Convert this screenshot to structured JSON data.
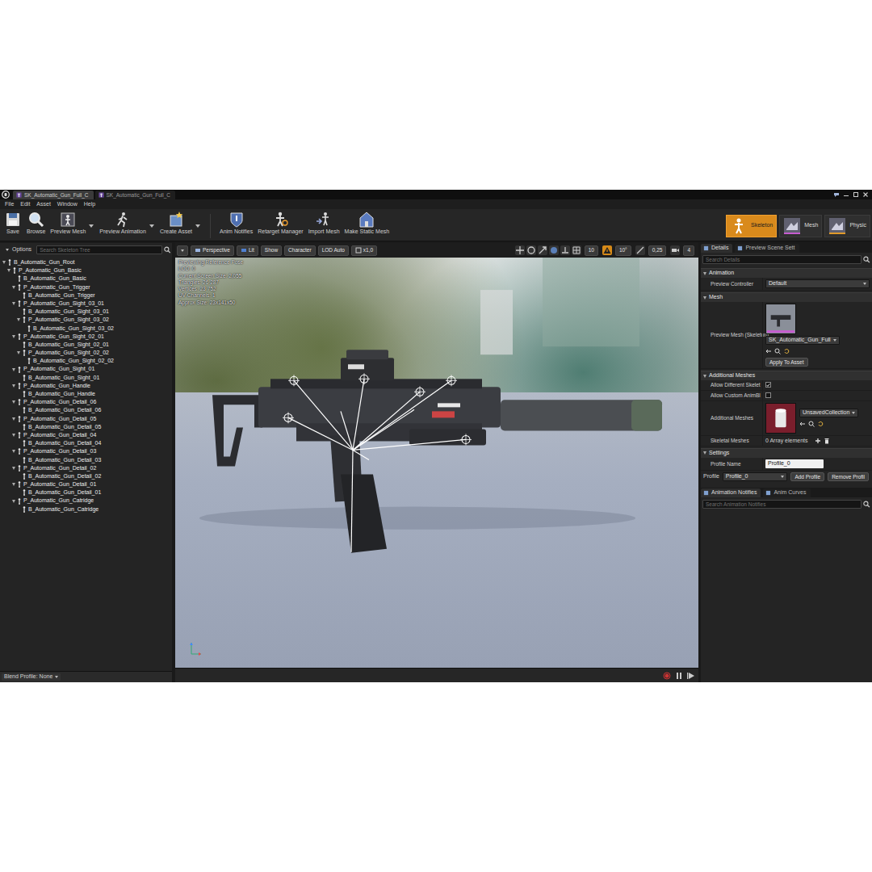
{
  "window": {
    "tabs": [
      {
        "label": "SK_Automatic_Gun_Full_C",
        "selected": true
      },
      {
        "label": "SK_Automatic_Gun_Full_C",
        "selected": false
      }
    ]
  },
  "menu": [
    "File",
    "Edit",
    "Asset",
    "Window",
    "Help"
  ],
  "toolbar": {
    "buttons": [
      {
        "label": "Save",
        "has_menu": false
      },
      {
        "label": "Browse",
        "has_menu": false
      },
      {
        "label": "Preview Mesh",
        "has_menu": true
      },
      {
        "label": "Preview Animation",
        "has_menu": true
      },
      {
        "label": "Create Asset",
        "has_menu": true
      },
      {
        "label": "Anim Notifies",
        "has_menu": false
      },
      {
        "label": "Retarget Manager",
        "has_menu": false
      },
      {
        "label": "Import Mesh",
        "has_menu": false
      },
      {
        "label": "Make Static Mesh",
        "has_menu": false
      }
    ],
    "modes": [
      {
        "label": "Skeleton",
        "selected": true
      },
      {
        "label": "Mesh",
        "selected": false
      },
      {
        "label": "Physic",
        "selected": false
      }
    ]
  },
  "skeleton_tree": {
    "options": "Options",
    "search": {
      "placeholder": "Search Skeleton Tree"
    },
    "items": [
      {
        "label": "B_Automatic_Gun_Root",
        "expanded": true,
        "children": [
          {
            "label": "P_Automatic_Gun_Basic",
            "expanded": true,
            "children": [
              {
                "label": "B_Automatic_Gun_Basic",
                "children": []
              },
              {
                "label": "P_Automatic_Gun_Trigger",
                "expanded": true,
                "children": [
                  {
                    "label": "B_Automatic_Gun_Trigger",
                    "children": []
                  }
                ]
              },
              {
                "label": "P_Automatic_Gun_Sight_03_01",
                "expanded": true,
                "children": [
                  {
                    "label": "B_Automatic_Gun_Sight_03_01",
                    "children": []
                  },
                  {
                    "label": "P_Automatic_Gun_Sight_03_02",
                    "expanded": true,
                    "children": [
                      {
                        "label": "B_Automatic_Gun_Sight_03_02",
                        "children": []
                      }
                    ]
                  }
                ]
              },
              {
                "label": "P_Automatic_Gun_Sight_02_01",
                "expanded": true,
                "children": [
                  {
                    "label": "B_Automatic_Gun_Sight_02_01",
                    "children": []
                  },
                  {
                    "label": "P_Automatic_Gun_Sight_02_02",
                    "expanded": true,
                    "children": [
                      {
                        "label": "B_Automatic_Gun_Sight_02_02",
                        "children": []
                      }
                    ]
                  }
                ]
              },
              {
                "label": "P_Automatic_Gun_Sight_01",
                "expanded": true,
                "children": [
                  {
                    "label": "B_Automatic_Gun_Sight_01",
                    "children": []
                  }
                ]
              },
              {
                "label": "P_Automatic_Gun_Handle",
                "expanded": true,
                "children": [
                  {
                    "label": "B_Automatic_Gun_Handle",
                    "children": []
                  }
                ]
              },
              {
                "label": "P_Automatic_Gun_Detail_06",
                "expanded": true,
                "children": [
                  {
                    "label": "B_Automatic_Gun_Detail_06",
                    "children": []
                  }
                ]
              },
              {
                "label": "P_Automatic_Gun_Detail_05",
                "expanded": true,
                "children": [
                  {
                    "label": "B_Automatic_Gun_Detail_05",
                    "children": []
                  }
                ]
              },
              {
                "label": "P_Automatic_Gun_Detail_04",
                "expanded": true,
                "children": [
                  {
                    "label": "B_Automatic_Gun_Detail_04",
                    "children": []
                  }
                ]
              },
              {
                "label": "P_Automatic_Gun_Detail_03",
                "expanded": true,
                "children": [
                  {
                    "label": "B_Automatic_Gun_Detail_03",
                    "children": []
                  }
                ]
              },
              {
                "label": "P_Automatic_Gun_Detail_02",
                "expanded": true,
                "children": [
                  {
                    "label": "B_Automatic_Gun_Detail_02",
                    "children": []
                  }
                ]
              },
              {
                "label": "P_Automatic_Gun_Detail_01",
                "expanded": true,
                "children": [
                  {
                    "label": "B_Automatic_Gun_Detail_01",
                    "children": []
                  }
                ]
              },
              {
                "label": "P_Automatic_Gun_Catridge",
                "expanded": true,
                "children": [
                  {
                    "label": "B_Automatic_Gun_Catridge",
                    "children": []
                  }
                ]
              }
            ]
          }
        ]
      }
    ],
    "blend_profile": "Blend Profile: None"
  },
  "viewport": {
    "toolbar_left": [
      "Perspective",
      "Lit",
      "Show",
      "Character",
      "LOD Auto",
      "x1,0"
    ],
    "toolbar_right": [
      "10",
      "10°",
      "0,25",
      "4"
    ],
    "info": [
      "Previewing Reference Pose",
      "LOD: 0",
      "Current Screen Size: 2,055",
      "Triangles: 26 287",
      "Vertices: 23 752",
      "UV Channels: 1",
      "Approx Size: 23x141x50"
    ]
  },
  "details": {
    "tabs": [
      {
        "label": "Details",
        "selected": true
      },
      {
        "label": "Preview Scene Sett",
        "selected": false
      }
    ],
    "search": {
      "placeholder": "Search Details"
    },
    "sections": [
      {
        "title": "Animation",
        "rows": [
          {
            "kind": "select",
            "label": "Preview Controller",
            "value": "Default"
          }
        ]
      },
      {
        "title": "Mesh",
        "rows": [
          {
            "kind": "asset",
            "label": "Preview Mesh (Skeleton)",
            "value": "SK_Automatic_Gun_Full",
            "button": "Apply To Asset"
          }
        ]
      },
      {
        "title": "Additional Meshes",
        "rows": [
          {
            "kind": "checkbox",
            "label": "Allow Different Skelet",
            "checked": true
          },
          {
            "kind": "checkbox",
            "label": "Allow Custom AnimBl",
            "checked": false
          },
          {
            "kind": "asset",
            "label": "Additional Meshes",
            "value": "UnsavedCollection",
            "button": ""
          },
          {
            "kind": "array",
            "label": "Skeletal Meshes",
            "value": "0 Array elements"
          }
        ]
      },
      {
        "title": "Settings",
        "rows": [
          {
            "kind": "text",
            "label": "Profile Name",
            "value": "Profile_0"
          },
          {
            "kind": "profile",
            "label": "Profile",
            "value": "Profile_0",
            "buttons": [
              "Add Profile",
              "Remove Profil"
            ]
          }
        ]
      }
    ]
  },
  "notifies": {
    "tabs": [
      {
        "label": "Animation Notifies",
        "selected": true
      },
      {
        "label": "Anim Curves",
        "selected": false
      }
    ],
    "search": {
      "placeholder": "Search Animation Notifies"
    }
  }
}
